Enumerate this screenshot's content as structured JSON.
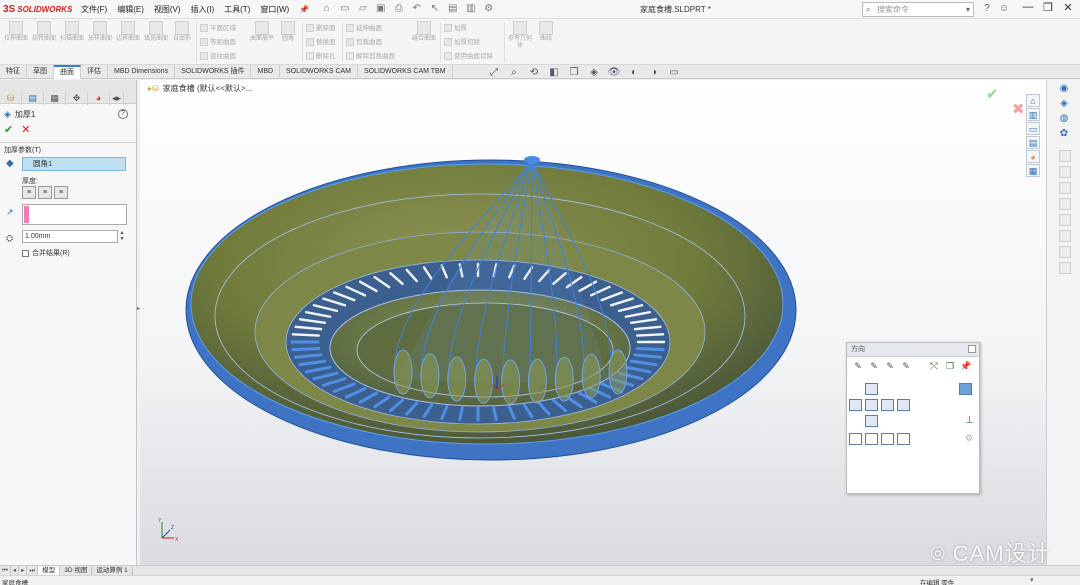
{
  "app": {
    "logo_ds": "3S",
    "logo_name": "SOLIDWORKS",
    "document_title": "家庭食槽.SLDPRT *",
    "menu": [
      "文件(F)",
      "编辑(E)",
      "视图(V)",
      "插入(I)",
      "工具(T)",
      "窗口(W)"
    ],
    "search_placeholder": "搜索命令",
    "search_icon": "magnifier-icon",
    "window_controls": [
      "—",
      "❐",
      "✕"
    ]
  },
  "ribbon": {
    "big_buttons": [
      "拉伸曲面",
      "旋转曲面",
      "扫描曲面",
      "放样曲面",
      "边界曲面",
      "填充曲面",
      "自由形",
      "平面区域",
      "等距曲面",
      "直纹曲面",
      "曲面展平",
      "圆角",
      "延伸曲面",
      "剪裁曲面",
      "解除剪裁曲面",
      "缝合曲面",
      "加厚",
      "加厚切除",
      "使用曲面切除",
      "参考几何体",
      "曲线"
    ],
    "small_buttons": [
      "平面区域",
      "等距曲面",
      "直纹曲面",
      "删除面",
      "替换面",
      "删除孔",
      "延伸曲面",
      "剪裁曲面",
      "解除剪裁曲面",
      "加厚",
      "加厚切除",
      "使用曲面切除"
    ]
  },
  "tabs": [
    "特征",
    "草图",
    "曲面",
    "评估",
    "MBD Dimensions",
    "SOLIDWORKS 插件",
    "MBD",
    "SOLIDWORKS CAM",
    "SOLIDWORKS CAM TBM"
  ],
  "active_tab": "曲面",
  "property_manager": {
    "feature_name": "加厚1",
    "group_title": "加厚参数(T)",
    "selected_face": "圆角1",
    "thickness_label": "厚度:",
    "thickness_value": "1.00mm",
    "merge_label": "合并结果(R)"
  },
  "viewport": {
    "tree_label": "家庭食槽 (默认<<默认>...",
    "model_colors": {
      "body": "#6f7a3b",
      "edge": "#3f86d8",
      "highlight": "#a7b2d8"
    }
  },
  "orientation_dialog": {
    "title": "方向"
  },
  "bottom_tabs": [
    "模型",
    "3D 视图",
    "运动算例 1"
  ],
  "status": {
    "left": "家庭食槽",
    "mode": "在编辑 零件",
    "unit": ""
  },
  "watermark": "CAM设计"
}
